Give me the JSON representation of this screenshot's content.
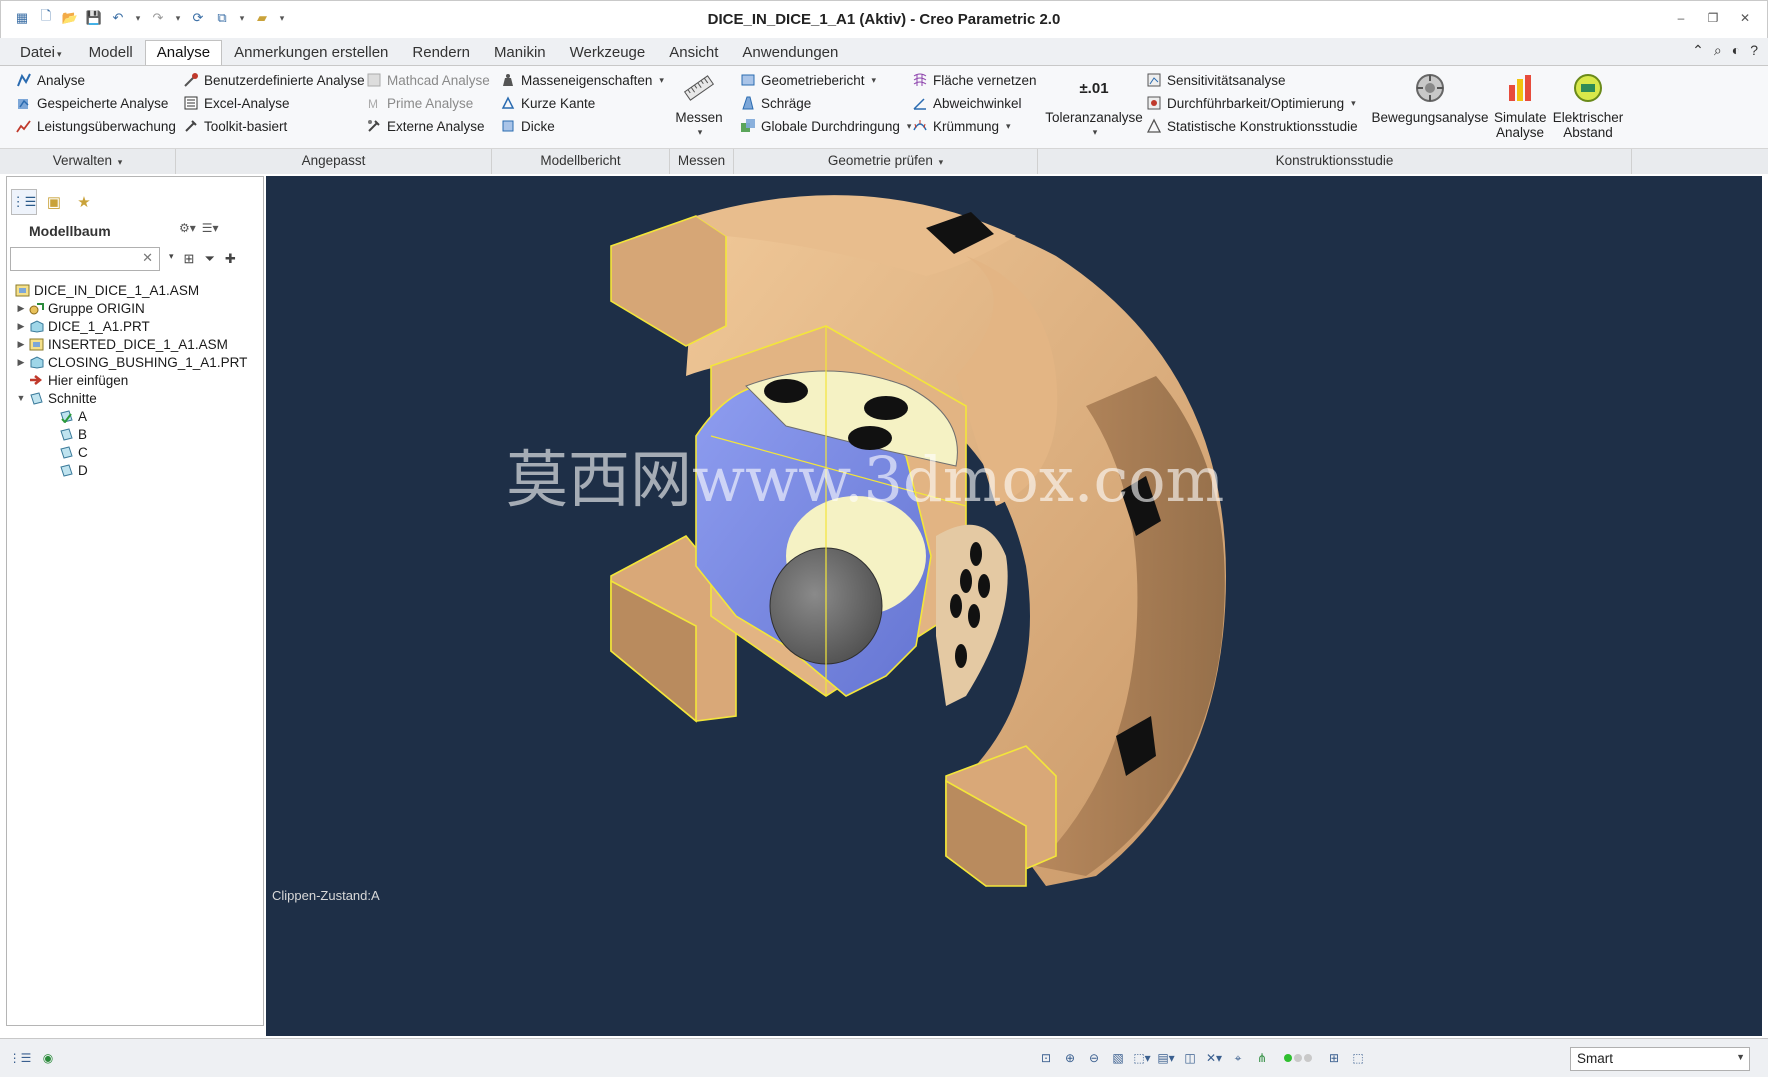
{
  "window": {
    "title": "DICE_IN_DICE_1_A1 (Aktiv) - Creo Parametric 2.0",
    "controls": [
      "minimize",
      "restore",
      "close"
    ]
  },
  "quick_access": [
    "app-icon",
    "new-icon",
    "open-icon",
    "save-icon",
    "undo-icon",
    "redo-icon",
    "regenerate-icon",
    "windows-icon",
    "close-window-icon",
    "customize-icon"
  ],
  "tabs": [
    {
      "label": "Datei"
    },
    {
      "label": "Modell"
    },
    {
      "label": "Analyse",
      "active": true
    },
    {
      "label": "Anmerkungen erstellen"
    },
    {
      "label": "Rendern"
    },
    {
      "label": "Manikin"
    },
    {
      "label": "Werkzeuge"
    },
    {
      "label": "Ansicht"
    },
    {
      "label": "Anwendungen"
    }
  ],
  "ribbon": {
    "verwalten": {
      "label": "Verwalten",
      "items": [
        "Analyse",
        "Gespeicherte Analyse",
        "Leistungsüberwachung"
      ]
    },
    "angepasst": {
      "label": "Angepasst",
      "col1": [
        "Benutzerdefinierte Analyse",
        "Excel-Analyse",
        "Toolkit-basiert"
      ],
      "col2": [
        "Mathcad Analyse",
        "Prime Analyse",
        "Externe Analyse"
      ]
    },
    "modellbericht": {
      "label": "Modellbericht",
      "items": [
        "Masseneigenschaften",
        "Kurze Kante",
        "Dicke"
      ]
    },
    "messen": {
      "label": "Messen",
      "button": "Messen"
    },
    "geometrie": {
      "label": "Geometrie prüfen",
      "col1": [
        "Geometriebericht",
        "Schräge",
        "Globale Durchdringung"
      ],
      "col2": [
        "Fläche vernetzen",
        "Abweichwinkel",
        "Krümmung"
      ],
      "toleranz": "Toleranzanalyse",
      "toleranz_glyph": "±.01"
    },
    "konstruktion": {
      "label": "Konstruktionsstudie",
      "items": [
        "Sensitivitätsanalyse",
        "Durchführbarkeit/Optimierung",
        "Statistische Konstruktionsstudie"
      ],
      "big": [
        "Bewegungsanalyse",
        "Simulate Analyse",
        "Elektrischer Abstand"
      ]
    }
  },
  "model_tree": {
    "header": "Modellbaum",
    "search_value": "",
    "items": [
      {
        "label": "DICE_IN_DICE_1_A1.ASM",
        "level": 0,
        "toggle": "",
        "icon": "assembly-icon"
      },
      {
        "label": "Gruppe ORIGIN",
        "level": 1,
        "toggle": "▶",
        "icon": "group-icon"
      },
      {
        "label": "DICE_1_A1.PRT",
        "level": 1,
        "toggle": "▶",
        "icon": "part-icon"
      },
      {
        "label": "INSERTED_DICE_1_A1.ASM",
        "level": 1,
        "toggle": "▶",
        "icon": "assembly-icon"
      },
      {
        "label": "CLOSING_BUSHING_1_A1.PRT",
        "level": 1,
        "toggle": "▶",
        "icon": "part-icon"
      },
      {
        "label": "Hier einfügen",
        "level": 1,
        "toggle": "",
        "icon": "insert-arrow-icon"
      },
      {
        "label": "Schnitte",
        "level": 1,
        "toggle": "▼",
        "icon": "sections-icon"
      },
      {
        "label": "A",
        "level": 2,
        "toggle": "",
        "icon": "section-active-icon"
      },
      {
        "label": "B",
        "level": 2,
        "toggle": "",
        "icon": "section-icon"
      },
      {
        "label": "C",
        "level": 2,
        "toggle": "",
        "icon": "section-icon"
      },
      {
        "label": "D",
        "level": 2,
        "toggle": "",
        "icon": "section-icon"
      }
    ]
  },
  "viewport": {
    "clip_label": "Clippen-Zustand:A",
    "watermark": "莫西网www.3dmox.com",
    "background": "#1e2f47",
    "colors": {
      "outer_body": "#e6b988",
      "outer_shadow": "#b98b5e",
      "inner_body": "#7f90e6",
      "cap": "#f5f2c4",
      "section_edge": "#f3e63a",
      "hole": "#111111"
    }
  },
  "statusbar": {
    "filter_value": "Smart",
    "status_colors": [
      "#2fbf2f",
      "#c9c9c9",
      "#c9c9c9"
    ]
  }
}
